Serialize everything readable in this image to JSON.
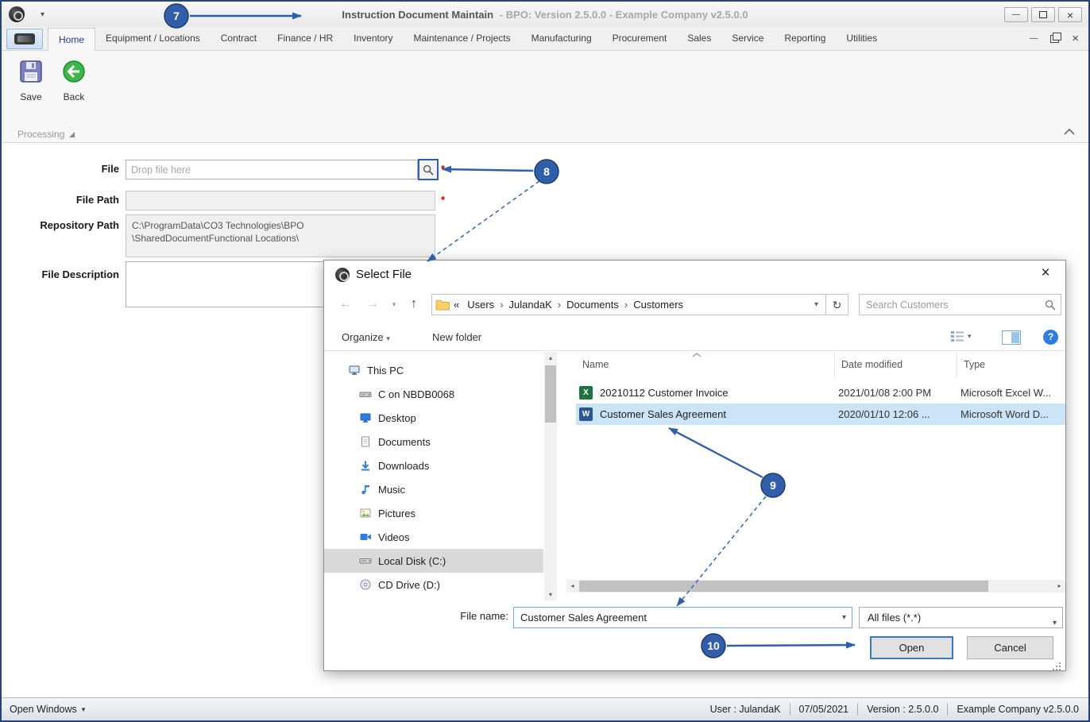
{
  "titlebar": {
    "title": "Instruction Document Maintain",
    "subtitle": "- BPO: Version 2.5.0.0 - Example Company v2.5.0.0"
  },
  "ribbon": {
    "tabs": [
      "Home",
      "Equipment / Locations",
      "Contract",
      "Finance / HR",
      "Inventory",
      "Maintenance / Projects",
      "Manufacturing",
      "Procurement",
      "Sales",
      "Service",
      "Reporting",
      "Utilities"
    ],
    "save_label": "Save",
    "back_label": "Back",
    "group_label": "Processing"
  },
  "form": {
    "file_label": "File",
    "file_placeholder": "Drop file here",
    "file_path_label": "File Path",
    "repository_path_label": "Repository Path",
    "repository_path_line1": "C:\\ProgramData\\CO3 Technologies\\BPO",
    "repository_path_line2": "\\SharedDocumentFunctional Locations\\",
    "file_description_label": "File Description",
    "required_marker": "*"
  },
  "dialog": {
    "title": "Select File",
    "breadcrumb": {
      "overflow": "«",
      "separator": "›",
      "items": [
        "Users",
        "JulandaK",
        "Documents",
        "Customers"
      ]
    },
    "search_placeholder": "Search Customers",
    "organize_label": "Organize",
    "new_folder_label": "New folder",
    "sidebar": [
      "This PC",
      "C on NBDB0068",
      "Desktop",
      "Documents",
      "Downloads",
      "Music",
      "Pictures",
      "Videos",
      "Local Disk (C:)",
      "CD Drive (D:)"
    ],
    "columns": {
      "name": "Name",
      "date_modified": "Date modified",
      "type": "Type"
    },
    "files": [
      {
        "name": "20210112 Customer Invoice",
        "date_modified": "2021/01/08 2:00 PM",
        "type": "Microsoft Excel W...",
        "icon_letter": "X"
      },
      {
        "name": "Customer Sales Agreement",
        "date_modified": "2020/01/10 12:06 ...",
        "type": "Microsoft Word D...",
        "icon_letter": "W"
      }
    ],
    "file_name_label": "File name:",
    "file_name_value": "Customer Sales Agreement",
    "file_type_value": "All files (*.*)",
    "open_label": "Open",
    "cancel_label": "Cancel"
  },
  "statusbar": {
    "open_windows_label": "Open Windows",
    "user": "User : JulandaK",
    "date": "07/05/2021",
    "version": "Version : 2.5.0.0",
    "company": "Example Company v2.5.0.0"
  },
  "annotations": {
    "step7": "7",
    "step8": "8",
    "step9": "9",
    "step10": "10"
  },
  "icons": {
    "caret_down": "▾",
    "back_arrow": "←",
    "forward_arrow": "→",
    "up_arrow": "↑",
    "refresh": "↻",
    "close": "×",
    "minimize": "—",
    "help": "?",
    "scroll_up": "▴",
    "scroll_down": "▾",
    "scroll_left": "◂",
    "scroll_right": "▸"
  }
}
